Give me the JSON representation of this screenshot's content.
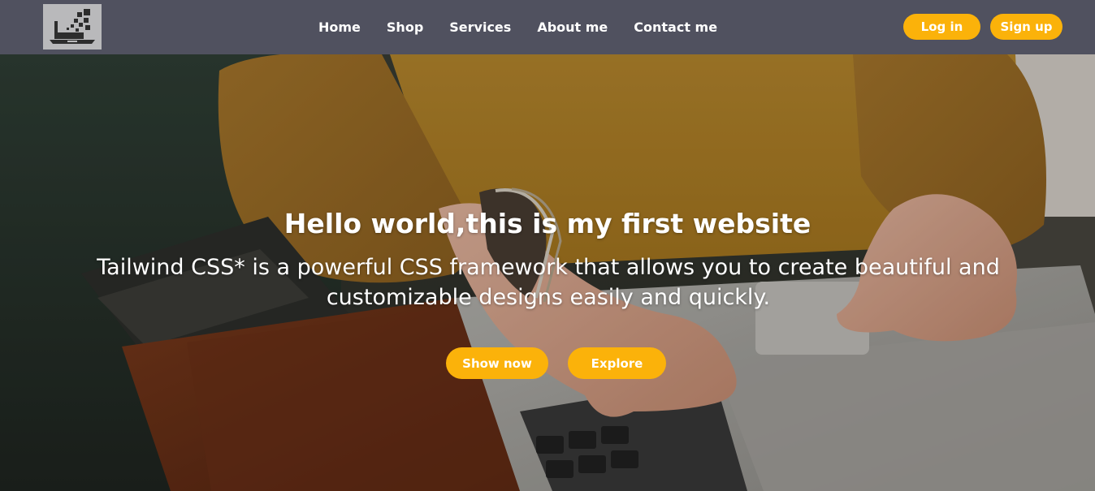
{
  "logo": {
    "icon": "laptop-pixel-logo-icon"
  },
  "nav": {
    "links": [
      {
        "label": "Home"
      },
      {
        "label": "Shop"
      },
      {
        "label": "Services"
      },
      {
        "label": "About me"
      },
      {
        "label": "Contact me"
      }
    ],
    "login_label": "Log in",
    "signup_label": "Sign up"
  },
  "hero": {
    "title": "Hello world,this is my first website",
    "subtitle": "Tailwind CSS* is a powerful CSS framework that allows you to create beautiful and customizable designs easily and quickly.",
    "primary_button": "Show now",
    "secondary_button": "Explore"
  },
  "colors": {
    "navbar_bg": "#50515f",
    "accent": "#fbb20a",
    "text": "#ffffff"
  }
}
